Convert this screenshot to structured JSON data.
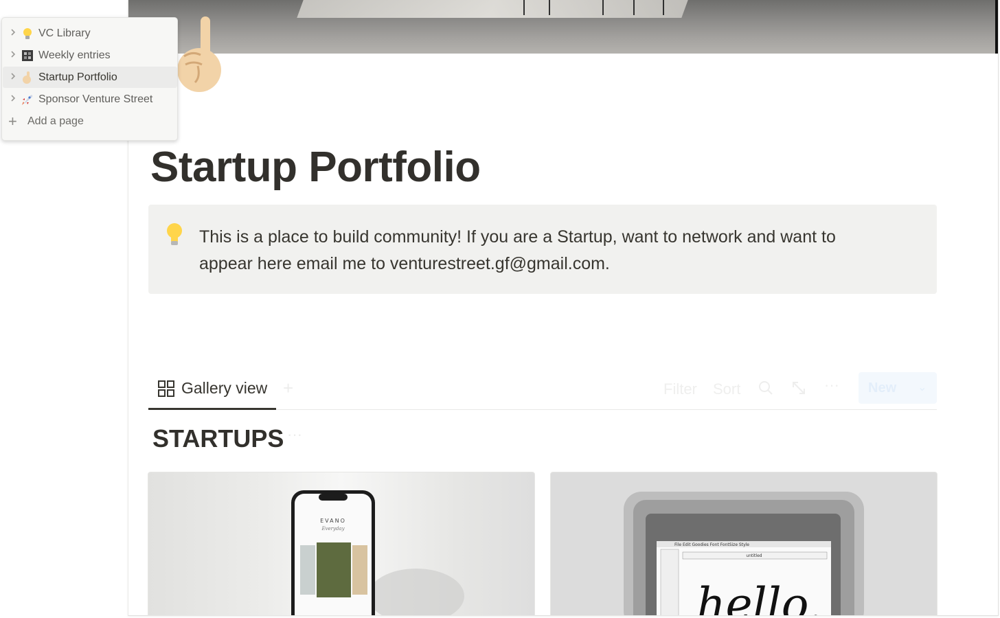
{
  "sidebar": {
    "items": [
      {
        "icon": "lightbulb-icon",
        "label": "VC Library"
      },
      {
        "icon": "notebook-icon",
        "label": "Weekly entries"
      },
      {
        "icon": "pointing-up-icon",
        "label": "Startup Portfolio"
      },
      {
        "icon": "rocket-icon",
        "label": "Sponsor Venture Street"
      }
    ],
    "add_label": "Add a page"
  },
  "page": {
    "title": "Startup Portfolio",
    "callout": "This is a place to build community! If you are a Startup, want to network and want to appear here email me to venturestreet.gf@gmail.com."
  },
  "database": {
    "view_label": "Gallery view",
    "toolbar": {
      "filter": "Filter",
      "sort": "Sort",
      "new": "New"
    },
    "title": "STARTUPS"
  },
  "cards": [
    {
      "phone_brand": "EVANO",
      "phone_tagline": "Everyday"
    },
    {
      "screen_word": "hello.",
      "menu": "File  Edit  Goodies  Font  FontSize  Style",
      "window_title": "untitled"
    }
  ],
  "colors": {
    "text": "#37352f",
    "callout_bg": "#f1f1ef",
    "sidebar_bg": "#f7f7f5",
    "active_bg": "#ebebea"
  }
}
